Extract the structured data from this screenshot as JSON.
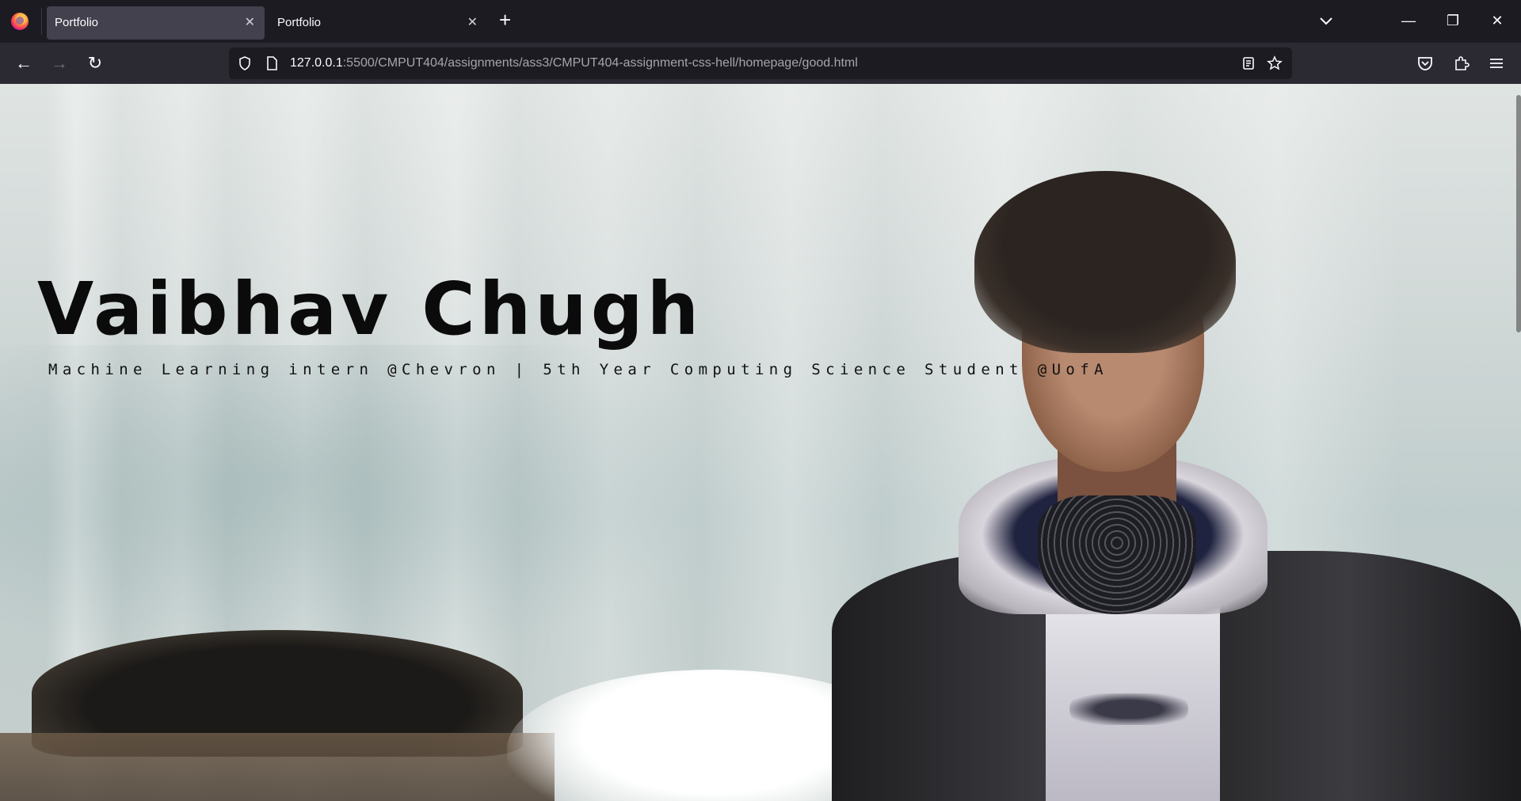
{
  "browser": {
    "tabs": [
      {
        "title": "Portfolio",
        "active": true
      },
      {
        "title": "Portfolio",
        "active": false
      }
    ],
    "url": {
      "host": "127.0.0.1",
      "rest": ":5500/CMPUT404/assignments/ass3/CMPUT404-assignment-css-hell/homepage/good.html"
    },
    "icons": {
      "close": "✕",
      "new_tab": "+",
      "back": "←",
      "forward": "→",
      "reload": "↻",
      "minimize": "—",
      "restore": "❐",
      "window_close": "✕"
    }
  },
  "hero": {
    "name": "Vaibhav Chugh",
    "subtitle": "Machine Learning intern @Chevron | 5th Year Computing Science Student @UofA"
  },
  "colors": {
    "chrome_bg": "#1c1b22",
    "nav_bg": "#2b2a33",
    "active_tab": "#42414d",
    "text": "#fbfbfe"
  }
}
